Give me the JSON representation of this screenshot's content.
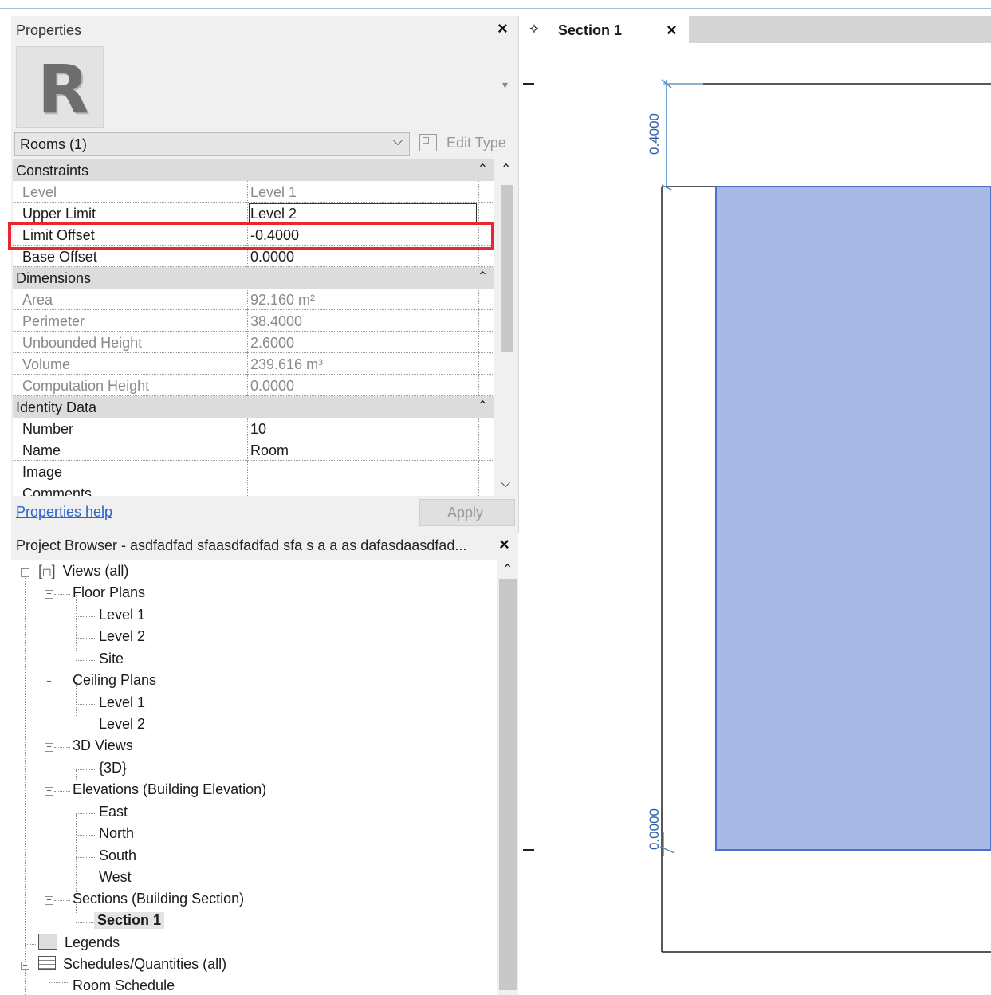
{
  "properties": {
    "title": "Properties",
    "type_selector": "Rooms (1)",
    "edit_type": "Edit Type",
    "groups": {
      "constraints": "Constraints",
      "dimensions": "Dimensions",
      "identity": "Identity Data"
    },
    "rows": {
      "level": {
        "k": "Level",
        "v": "Level 1"
      },
      "upper_limit": {
        "k": "Upper Limit",
        "v": "Level 2"
      },
      "limit_offset": {
        "k": "Limit Offset",
        "v": "-0.4000"
      },
      "base_offset": {
        "k": "Base Offset",
        "v": "0.0000"
      },
      "area": {
        "k": "Area",
        "v": "92.160 m²"
      },
      "perimeter": {
        "k": "Perimeter",
        "v": "38.4000"
      },
      "unbounded_height": {
        "k": "Unbounded Height",
        "v": "2.6000"
      },
      "volume": {
        "k": "Volume",
        "v": "239.616 m³"
      },
      "computation_height": {
        "k": "Computation Height",
        "v": "0.0000"
      },
      "number": {
        "k": "Number",
        "v": "10"
      },
      "name": {
        "k": "Name",
        "v": "Room"
      },
      "image": {
        "k": "Image",
        "v": ""
      },
      "comments": {
        "k": "Comments",
        "v": ""
      }
    },
    "help": "Properties help",
    "apply": "Apply"
  },
  "project_browser": {
    "title": "Project Browser - asdfadfad sfaasdfadfad sfa s a a as dafasdaasdfad...",
    "items": {
      "views": "Views (all)",
      "floor_plans": "Floor Plans",
      "fp_level1": "Level 1",
      "fp_level2": "Level 2",
      "fp_site": "Site",
      "ceiling_plans": "Ceiling Plans",
      "cp_level1": "Level 1",
      "cp_level2": "Level 2",
      "views3d": "3D Views",
      "view3d": "{3D}",
      "elevations": "Elevations (Building Elevation)",
      "east": "East",
      "north": "North",
      "south": "South",
      "west": "West",
      "sections": "Sections (Building Section)",
      "section1": "Section 1",
      "legends": "Legends",
      "schedules": "Schedules/Quantities (all)",
      "room_schedule": "Room Schedule"
    }
  },
  "view": {
    "tab_label": "Section 1",
    "dim_top": "0.4000",
    "dim_bottom": "0.0000",
    "room_fill": "#a9b9e6"
  },
  "icons": {
    "close": "×",
    "chevron_down": "⌄",
    "collapse": "⌃"
  }
}
